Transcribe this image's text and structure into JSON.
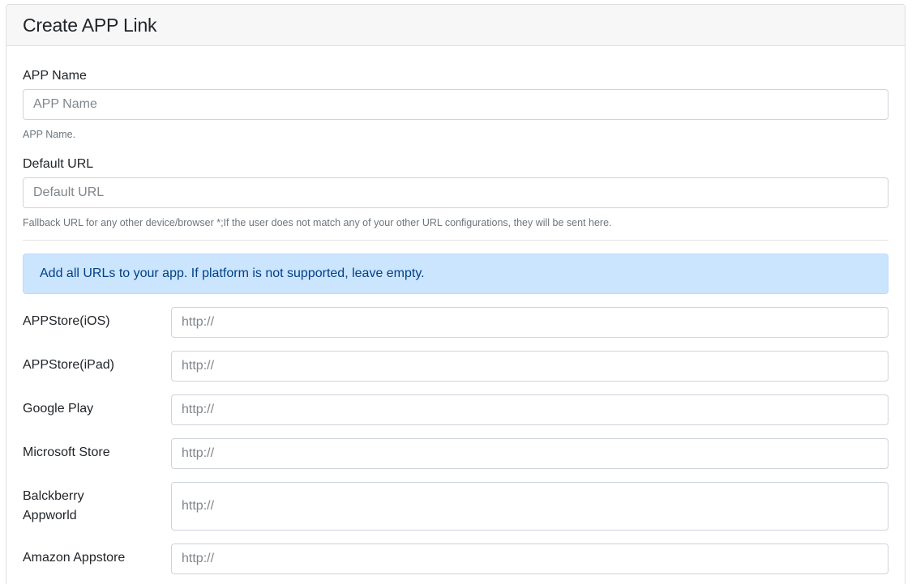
{
  "card": {
    "title": "Create APP Link"
  },
  "app_name": {
    "label": "APP Name",
    "placeholder": "APP Name",
    "help": "APP Name."
  },
  "default_url": {
    "label": "Default URL",
    "placeholder": "Default URL",
    "help": "Fallback URL for any other device/browser *;If the user does not match any of your other URL configurations, they will be sent here."
  },
  "notice": {
    "text": "Add all URLs to your app. If platform is not supported, leave empty."
  },
  "platforms": [
    {
      "label": "APPStore(iOS)",
      "placeholder": "http://"
    },
    {
      "label": "APPStore(iPad)",
      "placeholder": "http://"
    },
    {
      "label": "Google Play",
      "placeholder": "http://"
    },
    {
      "label": "Microsoft Store",
      "placeholder": "http://"
    },
    {
      "label": "Balckberry Appworld",
      "placeholder": "http://"
    },
    {
      "label": "Amazon Appstore",
      "placeholder": "http://"
    }
  ]
}
